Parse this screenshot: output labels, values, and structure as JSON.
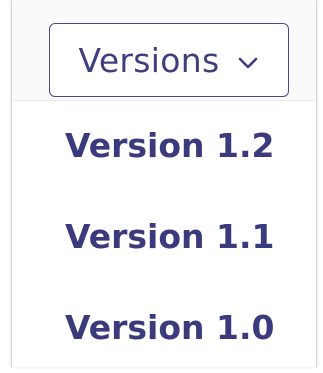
{
  "dropdown": {
    "button_label": "Versions",
    "icon": "chevron-down-icon",
    "items": [
      {
        "label": "Version 1.2"
      },
      {
        "label": "Version 1.1"
      },
      {
        "label": "Version 1.0"
      }
    ]
  },
  "colors": {
    "accent_text": "#3f3f80",
    "item_text": "#3a3a7d",
    "button_border": "#4a4a8a",
    "background": "#ffffff"
  }
}
